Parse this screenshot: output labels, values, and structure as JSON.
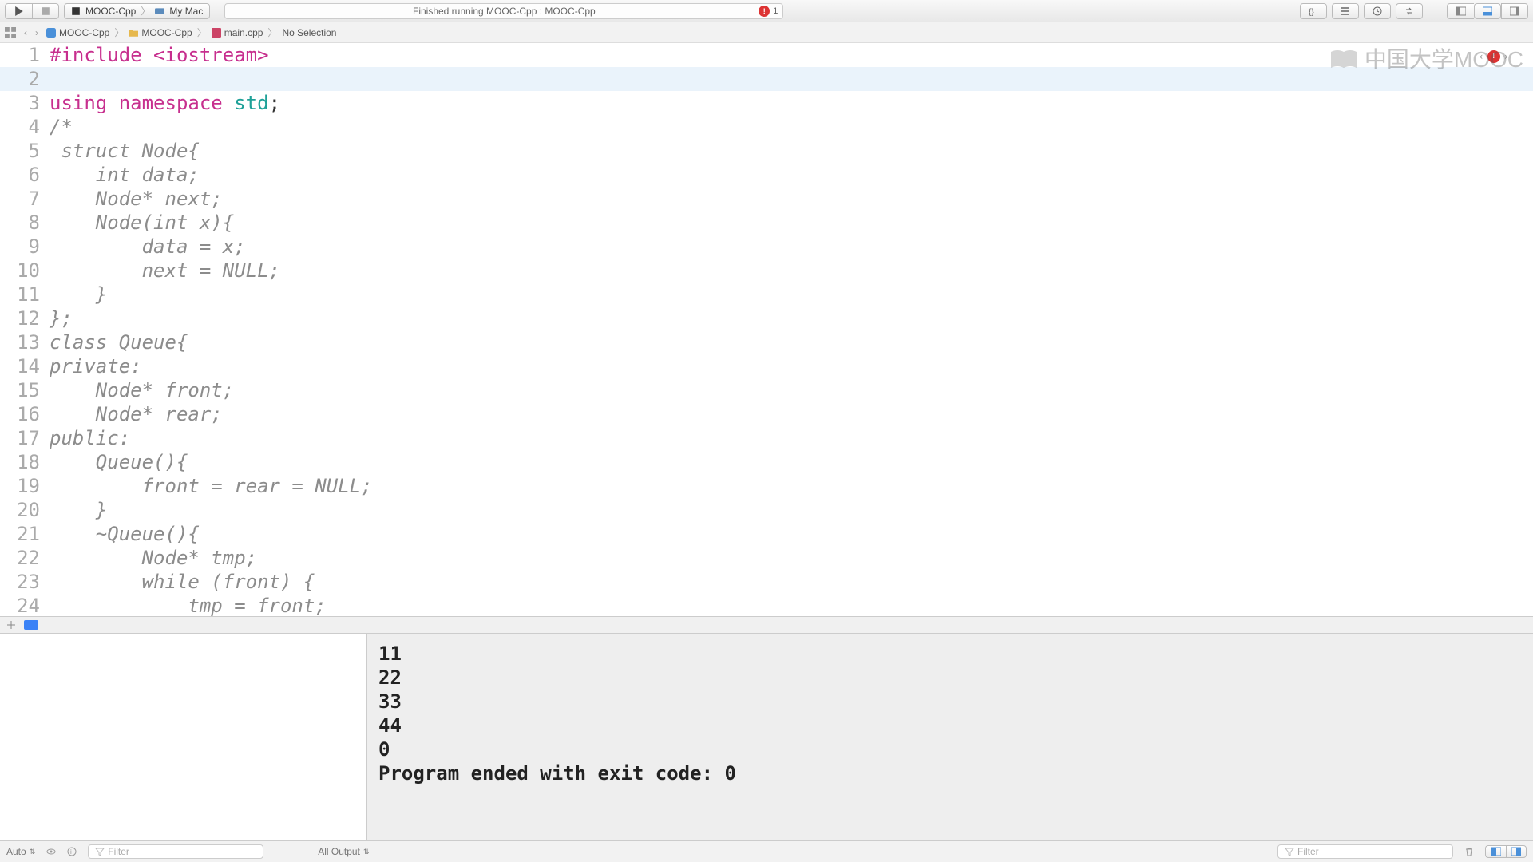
{
  "toolbar": {
    "scheme": "MOOC-Cpp",
    "destination": "My Mac",
    "status": "Finished running MOOC-Cpp : MOOC-Cpp",
    "error_count": "1"
  },
  "breadcrumb": {
    "project": "MOOC-Cpp",
    "folder": "MOOC-Cpp",
    "file": "main.cpp",
    "selection": "No Selection"
  },
  "watermark": "中国大学MOOC",
  "code": {
    "lines": [
      {
        "n": "1",
        "tokens": [
          {
            "t": "#include ",
            "c": "kw-pink"
          },
          {
            "t": "<iostream>",
            "c": "kw-pink"
          }
        ]
      },
      {
        "n": "2",
        "tokens": [],
        "hl": true
      },
      {
        "n": "3",
        "tokens": [
          {
            "t": "using ",
            "c": "kw-pink"
          },
          {
            "t": "namespace ",
            "c": "kw-pink"
          },
          {
            "t": "std",
            "c": "kw-teal"
          },
          {
            "t": ";",
            "c": ""
          }
        ]
      },
      {
        "n": "4",
        "tokens": [
          {
            "t": "/*",
            "c": "comment"
          }
        ]
      },
      {
        "n": "5",
        "tokens": [
          {
            "t": " struct Node{",
            "c": "comment"
          }
        ]
      },
      {
        "n": "6",
        "tokens": [
          {
            "t": "    int data;",
            "c": "comment"
          }
        ]
      },
      {
        "n": "7",
        "tokens": [
          {
            "t": "    Node* next;",
            "c": "comment"
          }
        ]
      },
      {
        "n": "8",
        "tokens": [
          {
            "t": "    Node(int x){",
            "c": "comment"
          }
        ]
      },
      {
        "n": "9",
        "tokens": [
          {
            "t": "        data = x;",
            "c": "comment"
          }
        ]
      },
      {
        "n": "10",
        "tokens": [
          {
            "t": "        next = NULL;",
            "c": "comment"
          }
        ]
      },
      {
        "n": "11",
        "tokens": [
          {
            "t": "    }",
            "c": "comment"
          }
        ]
      },
      {
        "n": "12",
        "tokens": [
          {
            "t": "};",
            "c": "comment"
          }
        ]
      },
      {
        "n": "13",
        "tokens": [
          {
            "t": "class Queue{",
            "c": "comment"
          }
        ]
      },
      {
        "n": "14",
        "tokens": [
          {
            "t": "private:",
            "c": "comment"
          }
        ]
      },
      {
        "n": "15",
        "tokens": [
          {
            "t": "    Node* front;",
            "c": "comment"
          }
        ]
      },
      {
        "n": "16",
        "tokens": [
          {
            "t": "    Node* rear;",
            "c": "comment"
          }
        ]
      },
      {
        "n": "17",
        "tokens": [
          {
            "t": "public:",
            "c": "comment"
          }
        ]
      },
      {
        "n": "18",
        "tokens": [
          {
            "t": "    Queue(){",
            "c": "comment"
          }
        ]
      },
      {
        "n": "19",
        "tokens": [
          {
            "t": "        front = rear = NULL;",
            "c": "comment"
          }
        ]
      },
      {
        "n": "20",
        "tokens": [
          {
            "t": "    }",
            "c": "comment"
          }
        ]
      },
      {
        "n": "21",
        "tokens": [
          {
            "t": "    ~Queue(){",
            "c": "comment"
          }
        ]
      },
      {
        "n": "22",
        "tokens": [
          {
            "t": "        Node* tmp;",
            "c": "comment"
          }
        ]
      },
      {
        "n": "23",
        "tokens": [
          {
            "t": "        while (front) {",
            "c": "comment"
          }
        ]
      },
      {
        "n": "24",
        "tokens": [
          {
            "t": "            tmp = front;",
            "c": "comment"
          }
        ]
      }
    ]
  },
  "console": {
    "lines": [
      "11",
      "22",
      "33",
      "44",
      "0"
    ],
    "exit": "Program ended with exit code: 0"
  },
  "bottom": {
    "auto": "Auto",
    "filter_placeholder": "Filter",
    "output_scope": "All Output"
  }
}
